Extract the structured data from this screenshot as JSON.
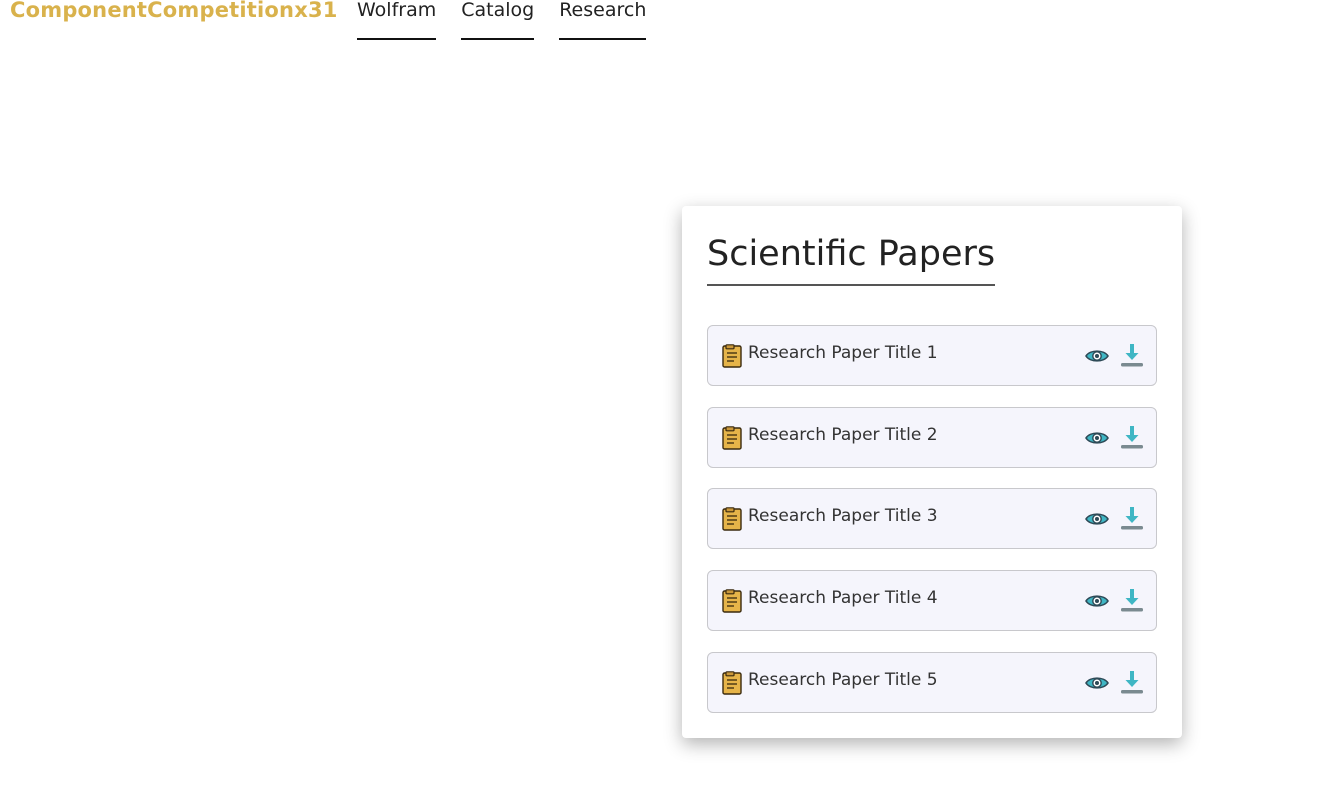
{
  "brand": "ComponentCompetitionx31",
  "nav": {
    "items": [
      {
        "label": "Wolfram"
      },
      {
        "label": "Catalog"
      },
      {
        "label": "Research"
      }
    ]
  },
  "card": {
    "title": "Scientific Papers",
    "papers": [
      {
        "title": "Research Paper Title 1"
      },
      {
        "title": "Research Paper Title 2"
      },
      {
        "title": "Research Paper Title 3"
      },
      {
        "title": "Research Paper Title 4"
      },
      {
        "title": "Research Paper Title 5"
      }
    ]
  },
  "icons": {
    "paper": "document-icon",
    "view": "eye-icon",
    "download": "download-icon"
  },
  "colors": {
    "brand": "#d9b24c",
    "accent": "#3fb6c4",
    "item_background": "#f5f5fc",
    "eye": "#2e4a57",
    "document": "#e6b449"
  }
}
